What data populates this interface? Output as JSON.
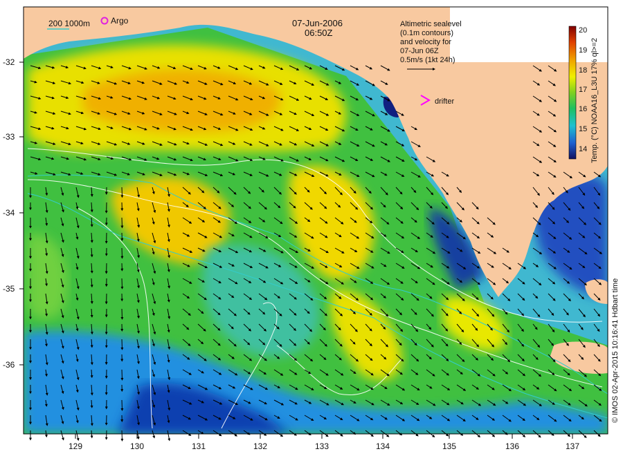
{
  "header": {
    "date": "07-Jun-2006",
    "time": "06:50Z"
  },
  "legend_depth": {
    "label": "200  1000m",
    "color": "#33cccc"
  },
  "legend_argo": {
    "label": "Argo",
    "color": "#e020e0"
  },
  "altimetry_note": {
    "lines": [
      "Altimetric sealevel",
      "(0.1m contours)",
      "and velocity for",
      "07-Jun 06Z",
      "0.5m/s (1kt 24h)"
    ]
  },
  "drifter": {
    "label": "drifter",
    "color": "#ff00ff"
  },
  "colorbar": {
    "title": "Temp. (°C) NOAA16_L3U 17% ql>=2",
    "ticks": [
      "20",
      "19",
      "18",
      "17",
      "16",
      "15",
      "14"
    ],
    "min": 13.5,
    "max": 20.0
  },
  "credit": "© IMOS 02-Apr-2015 10:16:41 Hdbart time",
  "axes": {
    "x_ticks": [
      "129",
      "130",
      "131",
      "132",
      "133",
      "134",
      "135",
      "136",
      "137"
    ],
    "y_ticks": [
      "-32",
      "-33",
      "-34",
      "-35",
      "-36"
    ]
  },
  "colors": {
    "land": "#f8c9a0",
    "sst_warm": "#f0b800",
    "sst_mid": "#40c040",
    "sst_cool": "#20a0e0",
    "sst_cold": "#1030a0"
  }
}
